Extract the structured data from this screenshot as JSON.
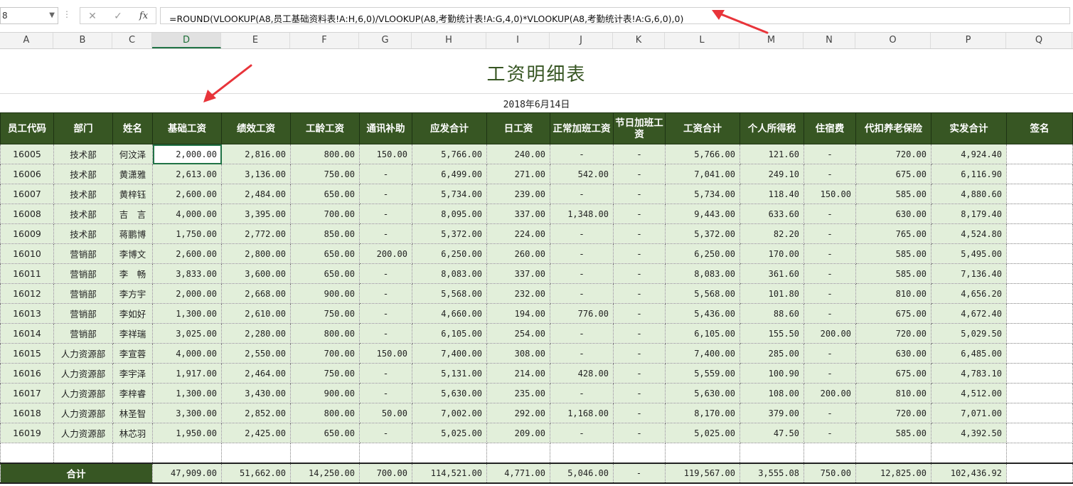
{
  "formula_bar": {
    "name_box": "8",
    "cancel_icon": "✕",
    "enter_icon": "✓",
    "fx_label": "fx",
    "formula": "=ROUND(VLOOKUP(A8,员工基础资料表!A:H,6,0)/VLOOKUP(A8,考勤统计表!A:G,4,0)*VLOOKUP(A8,考勤统计表!A:G,6,0),0)"
  },
  "columns": [
    "A",
    "B",
    "C",
    "D",
    "E",
    "F",
    "G",
    "H",
    "I",
    "J",
    "K",
    "L",
    "M",
    "N",
    "O",
    "P",
    "Q"
  ],
  "selected_column": "D",
  "sheet": {
    "title": "工资明细表",
    "date": "2018年6月14日",
    "headers": [
      "员工代码",
      "部门",
      "姓名",
      "基础工资",
      "绩效工资",
      "工龄工资",
      "通讯补助",
      "应发合计",
      "日工资",
      "正常加班工资",
      "节日加班工资",
      "工资合计",
      "个人所得税",
      "住宿费",
      "代扣养老保险",
      "实发合计",
      "签名"
    ],
    "rows": [
      [
        "16005",
        "技术部",
        "何汶泽",
        "2,000.00",
        "2,816.00",
        "800.00",
        "150.00",
        "5,766.00",
        "240.00",
        "-",
        "-",
        "5,766.00",
        "121.60",
        "-",
        "720.00",
        "4,924.40",
        ""
      ],
      [
        "16006",
        "技术部",
        "黄潇雅",
        "2,613.00",
        "3,136.00",
        "750.00",
        "-",
        "6,499.00",
        "271.00",
        "542.00",
        "-",
        "7,041.00",
        "249.10",
        "-",
        "675.00",
        "6,116.90",
        ""
      ],
      [
        "16007",
        "技术部",
        "黄梓钰",
        "2,600.00",
        "2,484.00",
        "650.00",
        "-",
        "5,734.00",
        "239.00",
        "-",
        "-",
        "5,734.00",
        "118.40",
        "150.00",
        "585.00",
        "4,880.60",
        ""
      ],
      [
        "16008",
        "技术部",
        "吉　言",
        "4,000.00",
        "3,395.00",
        "700.00",
        "-",
        "8,095.00",
        "337.00",
        "1,348.00",
        "-",
        "9,443.00",
        "633.60",
        "-",
        "630.00",
        "8,179.40",
        ""
      ],
      [
        "16009",
        "技术部",
        "蒋鹏博",
        "1,750.00",
        "2,772.00",
        "850.00",
        "-",
        "5,372.00",
        "224.00",
        "-",
        "-",
        "5,372.00",
        "82.20",
        "-",
        "765.00",
        "4,524.80",
        ""
      ],
      [
        "16010",
        "营销部",
        "李博文",
        "2,600.00",
        "2,800.00",
        "650.00",
        "200.00",
        "6,250.00",
        "260.00",
        "-",
        "-",
        "6,250.00",
        "170.00",
        "-",
        "585.00",
        "5,495.00",
        ""
      ],
      [
        "16011",
        "营销部",
        "李　畅",
        "3,833.00",
        "3,600.00",
        "650.00",
        "-",
        "8,083.00",
        "337.00",
        "-",
        "-",
        "8,083.00",
        "361.60",
        "-",
        "585.00",
        "7,136.40",
        ""
      ],
      [
        "16012",
        "营销部",
        "李方宇",
        "2,000.00",
        "2,668.00",
        "900.00",
        "-",
        "5,568.00",
        "232.00",
        "-",
        "-",
        "5,568.00",
        "101.80",
        "-",
        "810.00",
        "4,656.20",
        ""
      ],
      [
        "16013",
        "营销部",
        "李如好",
        "1,300.00",
        "2,610.00",
        "750.00",
        "-",
        "4,660.00",
        "194.00",
        "776.00",
        "-",
        "5,436.00",
        "88.60",
        "-",
        "675.00",
        "4,672.40",
        ""
      ],
      [
        "16014",
        "营销部",
        "李祥瑞",
        "3,025.00",
        "2,280.00",
        "800.00",
        "-",
        "6,105.00",
        "254.00",
        "-",
        "-",
        "6,105.00",
        "155.50",
        "200.00",
        "720.00",
        "5,029.50",
        ""
      ],
      [
        "16015",
        "人力资源部",
        "李宣蓉",
        "4,000.00",
        "2,550.00",
        "700.00",
        "150.00",
        "7,400.00",
        "308.00",
        "-",
        "-",
        "7,400.00",
        "285.00",
        "-",
        "630.00",
        "6,485.00",
        ""
      ],
      [
        "16016",
        "人力资源部",
        "李宇泽",
        "1,917.00",
        "2,464.00",
        "750.00",
        "-",
        "5,131.00",
        "214.00",
        "428.00",
        "-",
        "5,559.00",
        "100.90",
        "-",
        "675.00",
        "4,783.10",
        ""
      ],
      [
        "16017",
        "人力资源部",
        "李梓睿",
        "1,300.00",
        "3,430.00",
        "900.00",
        "-",
        "5,630.00",
        "235.00",
        "-",
        "-",
        "5,630.00",
        "108.00",
        "200.00",
        "810.00",
        "4,512.00",
        ""
      ],
      [
        "16018",
        "人力资源部",
        "林圣智",
        "3,300.00",
        "2,852.00",
        "800.00",
        "50.00",
        "7,002.00",
        "292.00",
        "1,168.00",
        "-",
        "8,170.00",
        "379.00",
        "-",
        "720.00",
        "7,071.00",
        ""
      ],
      [
        "16019",
        "人力资源部",
        "林芯羽",
        "1,950.00",
        "2,425.00",
        "650.00",
        "-",
        "5,025.00",
        "209.00",
        "-",
        "-",
        "5,025.00",
        "47.50",
        "-",
        "585.00",
        "4,392.50",
        ""
      ]
    ],
    "totals": {
      "label": "合计",
      "values": [
        "47,909.00",
        "51,662.00",
        "14,250.00",
        "700.00",
        "114,521.00",
        "4,771.00",
        "5,046.00",
        "-",
        "119,567.00",
        "3,555.08",
        "750.00",
        "12,825.00",
        "102,436.92",
        ""
      ]
    }
  },
  "colors": {
    "header_bg": "#375623",
    "row_bg": "#e2efda",
    "title_color": "#375623",
    "arrow_color": "#e8343a"
  }
}
